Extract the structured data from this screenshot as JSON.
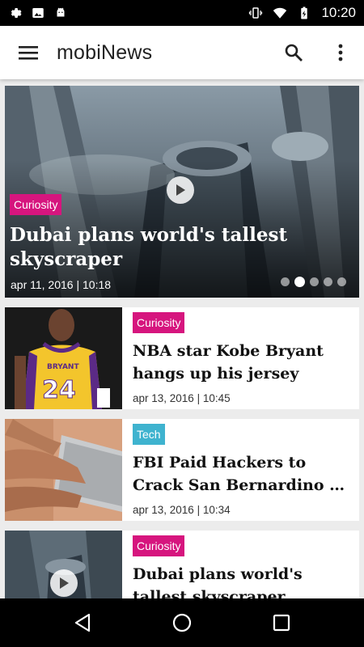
{
  "status_bar": {
    "time": "10:20",
    "left_icons": [
      "settings-gear-icon",
      "photo-icon",
      "android-icon"
    ],
    "right_icons": [
      "vibrate-icon",
      "wifi-icon",
      "battery-charging-icon"
    ]
  },
  "app_bar": {
    "title": "mobiNews",
    "menu_icon": "hamburger-menu-icon",
    "search_icon": "search-icon",
    "overflow_icon": "more-vert-icon"
  },
  "hero": {
    "category": "Curiosity",
    "title": "Dubai plans world's tallest skyscraper",
    "date": "apr 11, 2016 | 10:18",
    "has_video": true,
    "carousel_pages": 5,
    "carousel_active_index": 1
  },
  "articles": [
    {
      "category": "Curiosity",
      "category_type": "curiosity",
      "title": "NBA star Kobe Bryant hangs up his jersey",
      "date": "apr 13, 2016 | 10:45"
    },
    {
      "category": "Tech",
      "category_type": "tech",
      "title": "FBI Paid Hackers to Crack San Bernardino …",
      "date": "apr 13, 2016 | 10:34"
    },
    {
      "category": "Curiosity",
      "category_type": "curiosity",
      "title": "Dubai plans world's tallest skyscraper",
      "date": ""
    }
  ],
  "colors": {
    "curiosity": "#d6157e",
    "tech": "#3fb3cf",
    "background": "#ececec"
  },
  "nav_bar": {
    "icons": [
      "back-icon",
      "home-icon",
      "recents-icon"
    ]
  }
}
